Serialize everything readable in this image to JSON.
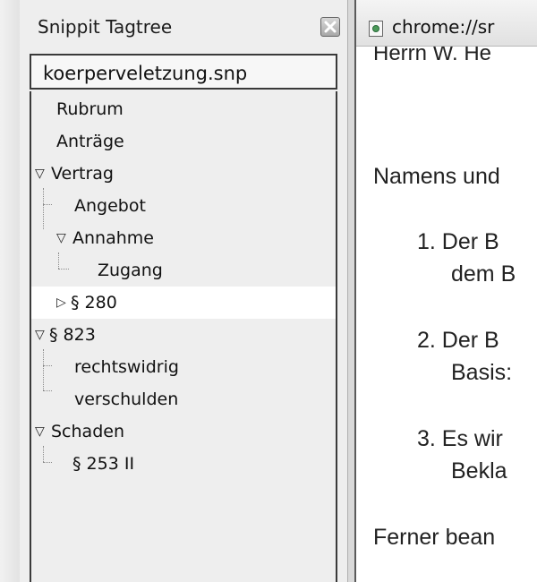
{
  "sidebar": {
    "title": "Snippit Tagtree",
    "file": "koerperveletzung.snp",
    "tree": [
      {
        "label": "Rubrum",
        "twisty": "",
        "selected": false
      },
      {
        "label": "Anträge",
        "twisty": "",
        "selected": false
      },
      {
        "label": "Vertrag",
        "twisty": "open",
        "selected": false
      },
      {
        "label": "Angebot",
        "twisty": "",
        "selected": false
      },
      {
        "label": "Annahme",
        "twisty": "open",
        "selected": false
      },
      {
        "label": "Zugang",
        "twisty": "",
        "selected": false
      },
      {
        "label": "§ 280",
        "twisty": "closed",
        "selected": true
      },
      {
        "label": "§ 823",
        "twisty": "open",
        "selected": false
      },
      {
        "label": "rechtswidrig",
        "twisty": "",
        "selected": false
      },
      {
        "label": "verschulden",
        "twisty": "",
        "selected": false
      },
      {
        "label": "Schaden",
        "twisty": "open",
        "selected": false
      },
      {
        "label": "§ 253 II",
        "twisty": "",
        "selected": false
      }
    ],
    "icons": {
      "close": "close-icon",
      "expanded": "triangle-down-icon",
      "collapsed": "triangle-right-icon"
    }
  },
  "browser": {
    "tab_url": "chrome://sr",
    "cut_top_line": "Herrn W. He",
    "lines": [
      "Namens und",
      "1.  Der B",
      "dem B",
      "2.  Der B",
      "Basis:",
      "3.  Es wir",
      "Bekla",
      "Ferner bean"
    ]
  }
}
